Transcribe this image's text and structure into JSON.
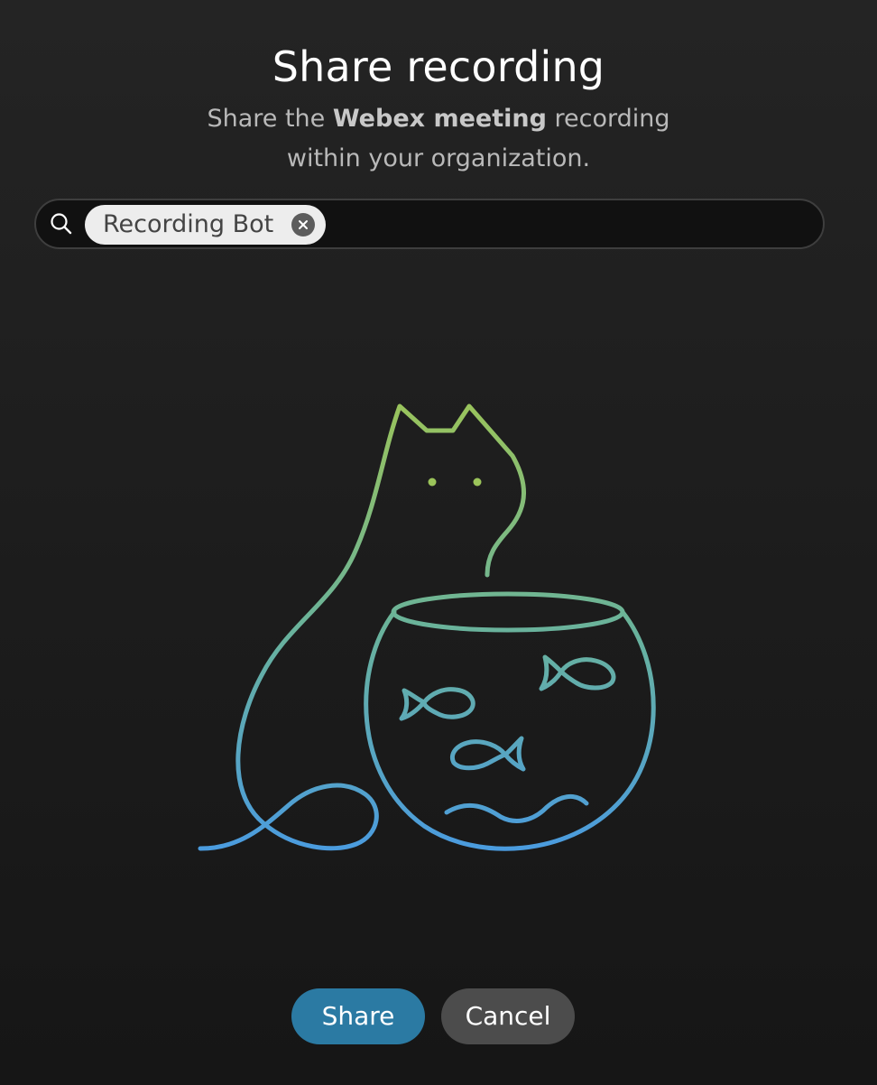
{
  "dialog": {
    "title": "Share recording",
    "subtitle": {
      "prefix": "Share the ",
      "emphasis": "Webex meeting",
      "suffix": " recording within your organization."
    }
  },
  "search": {
    "icon": "search-icon",
    "chip_label": "Recording Bot",
    "chip_remove_icon": "close-icon",
    "value": ""
  },
  "illustration": {
    "subject": "cat-and-fishbowl",
    "gradient": [
      "#9bc45a",
      "#6ab39a",
      "#4a9be0"
    ]
  },
  "actions": {
    "share_label": "Share",
    "cancel_label": "Cancel"
  },
  "colors": {
    "share_button": "#2b7aa3",
    "cancel_button": "#4c4c4c",
    "chip_background": "#ededed"
  }
}
